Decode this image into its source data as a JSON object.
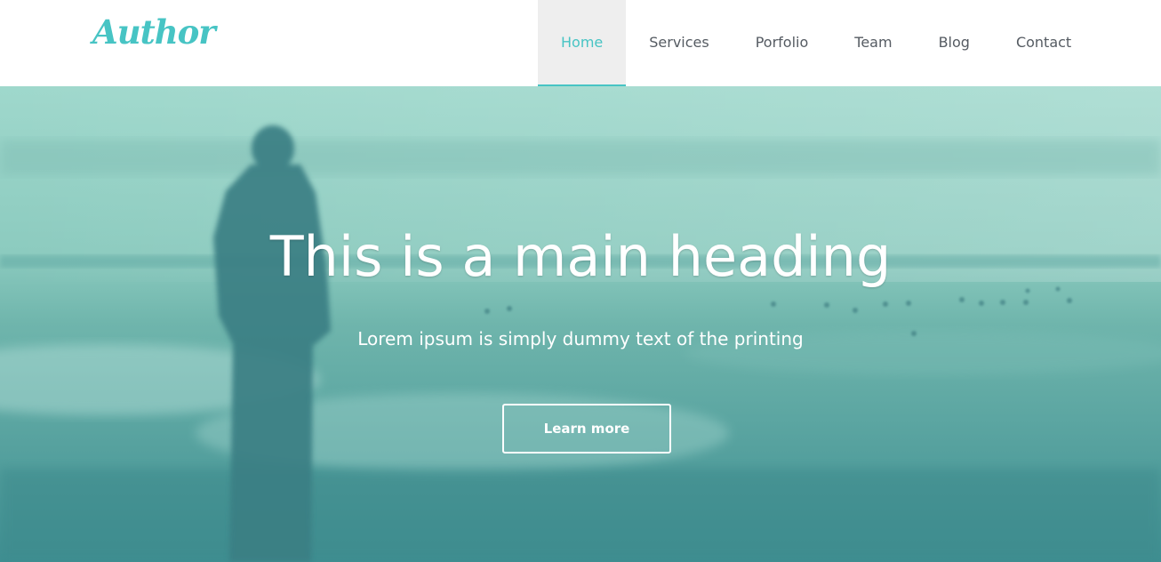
{
  "brand": {
    "name": "Author",
    "color": "#47c4c4"
  },
  "nav": {
    "items": [
      {
        "label": "Home",
        "active": true
      },
      {
        "label": "Services"
      },
      {
        "label": "Porfolio"
      },
      {
        "label": "Team"
      },
      {
        "label": "Blog"
      },
      {
        "label": "Contact"
      }
    ],
    "active_color": "#47c4c4",
    "active_bg": "#eeeeee"
  },
  "hero": {
    "title": "This is a main heading",
    "subtitle": "Lorem ipsum is simply dummy text of the printing",
    "button_label": "Learn more",
    "overlay_color": "#5fb8ae"
  }
}
